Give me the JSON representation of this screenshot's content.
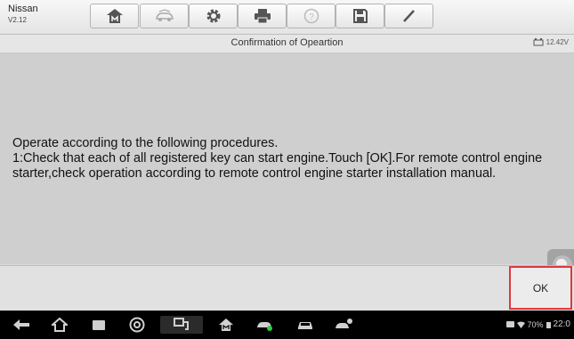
{
  "app": {
    "name": "Nissan",
    "version": "V2.12"
  },
  "toolbar": {
    "buttons": [
      {
        "name": "home-icon"
      },
      {
        "name": "car-swap-icon"
      },
      {
        "name": "settings-icon"
      },
      {
        "name": "print-icon"
      },
      {
        "name": "help-icon"
      },
      {
        "name": "save-icon"
      },
      {
        "name": "pen-icon"
      }
    ]
  },
  "titlebar": {
    "title": "Confirmation of Opeartion",
    "voltage": "12.42V"
  },
  "message": {
    "line1": "Operate according to the following procedures.",
    "line2": "1:Check that each of all registered key can start engine.Touch [OK].For remote control engine starter,check operation according to remote control engine starter installation manual."
  },
  "actions": {
    "ok_label": "OK"
  },
  "statusbar": {
    "battery": "70%",
    "time": "22:0"
  },
  "colors": {
    "highlight": "#e0393e",
    "background": "#cfcfcf",
    "navbar": "#000000"
  }
}
